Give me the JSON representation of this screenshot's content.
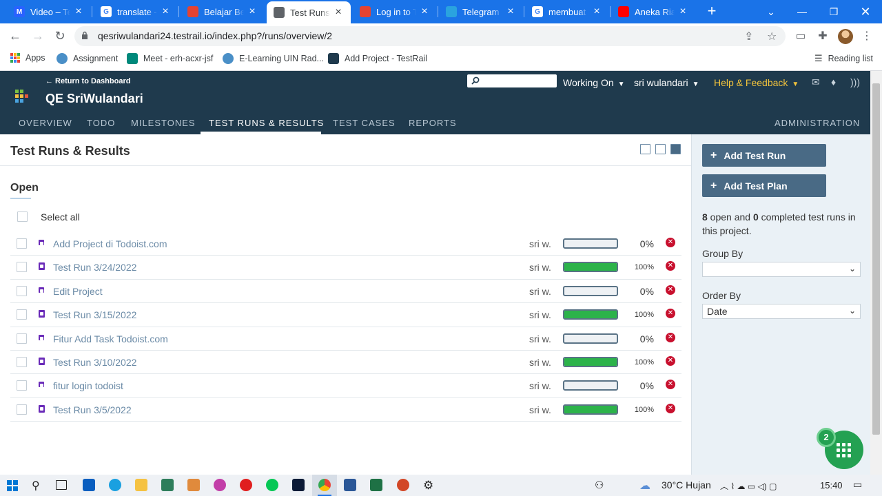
{
  "browser": {
    "tabs": [
      {
        "title": "Video – Test",
        "icon_color": "#2962ff",
        "icon_letter": "M",
        "icon": "m-icon"
      },
      {
        "title": "translate - Penelusuran",
        "icon_color": "#ffffff",
        "icon_letter": "G",
        "icon": "google-icon"
      },
      {
        "title": "Belajar Bersama",
        "icon_color": "#e44332",
        "icon_letter": "",
        "icon": "todoist-icon"
      },
      {
        "title": "Test Runs & Results",
        "icon_color": "#5f6368",
        "icon_letter": "",
        "icon": "globe-icon"
      },
      {
        "title": "Log in to Todoist",
        "icon_color": "#e44332",
        "icon_letter": "",
        "icon": "todoist-icon"
      },
      {
        "title": "Telegram",
        "icon_color": "#2aa3df",
        "icon_letter": "",
        "icon": "telegram-icon"
      },
      {
        "title": "membuat null",
        "icon_color": "#ffffff",
        "icon_letter": "G",
        "icon": "google-icon"
      },
      {
        "title": "Aneka Riasan",
        "icon_color": "#ff0000",
        "icon_letter": "",
        "icon": "youtube-icon"
      }
    ],
    "url": "qesriwulandari24.testrail.io/index.php?/runs/overview/2",
    "bookmarks": [
      {
        "label": "Apps",
        "icon": "apps-grid-icon"
      },
      {
        "label": "Assignment",
        "icon": "moodle-icon"
      },
      {
        "label": "Meet - erh-acxr-jsf",
        "icon": "meet-icon"
      },
      {
        "label": "E-Learning UIN Rad...",
        "icon": "elearning-icon"
      },
      {
        "label": "Add Project - TestRail",
        "icon": "testrail-icon"
      }
    ],
    "reading_list": "Reading list"
  },
  "header": {
    "return_link": "← Return to Dashboard",
    "project": "QE SriWulandari",
    "working_on": "Working On",
    "user": "sri wulandari",
    "help": "Help & Feedback",
    "nav": [
      "OVERVIEW",
      "TODO",
      "MILESTONES",
      "TEST RUNS & RESULTS",
      "TEST CASES",
      "REPORTS"
    ],
    "nav_active": "TEST RUNS & RESULTS",
    "admin": "ADMINISTRATION"
  },
  "main": {
    "title": "Test Runs & Results",
    "section": "Open",
    "select_all": "Select all",
    "runs": [
      {
        "name": "Add Project di Todoist.com",
        "user": "sri w.",
        "progress": 0,
        "pct": "0%",
        "type": "plan"
      },
      {
        "name": "Test Run 3/24/2022",
        "user": "sri w.",
        "progress": 100,
        "pct": "100%",
        "type": "run"
      },
      {
        "name": "Edit Project",
        "user": "sri w.",
        "progress": 0,
        "pct": "0%",
        "type": "plan"
      },
      {
        "name": "Test Run 3/15/2022",
        "user": "sri w.",
        "progress": 100,
        "pct": "100%",
        "type": "run"
      },
      {
        "name": "Fitur Add Task Todoist.com",
        "user": "sri w.",
        "progress": 0,
        "pct": "0%",
        "type": "plan"
      },
      {
        "name": "Test Run 3/10/2022",
        "user": "sri w.",
        "progress": 100,
        "pct": "100%",
        "type": "run"
      },
      {
        "name": "fitur login todoist",
        "user": "sri w.",
        "progress": 0,
        "pct": "0%",
        "type": "plan"
      },
      {
        "name": "Test Run 3/5/2022",
        "user": "sri w.",
        "progress": 100,
        "pct": "100%",
        "type": "run"
      }
    ]
  },
  "sidebar": {
    "add_run": "Add Test Run",
    "add_plan": "Add Test Plan",
    "open_count": "8",
    "completed_count": "0",
    "summary_mid": " open and ",
    "summary_end": " completed test runs in this project.",
    "group_by_label": "Group By",
    "group_by_value": "",
    "order_by_label": "Order By",
    "order_by_value": "Date"
  },
  "widget": {
    "badge": "2"
  },
  "taskbar": {
    "weather": "30°C  Hujan",
    "time": "15:40"
  },
  "colors": {
    "accent": "#1a73e8",
    "header_bg": "#1f3a4d",
    "help_link": "#f3c43c",
    "progress_fill": "#2cb34a",
    "delete": "#c8102e",
    "button_bg": "#496a85"
  }
}
